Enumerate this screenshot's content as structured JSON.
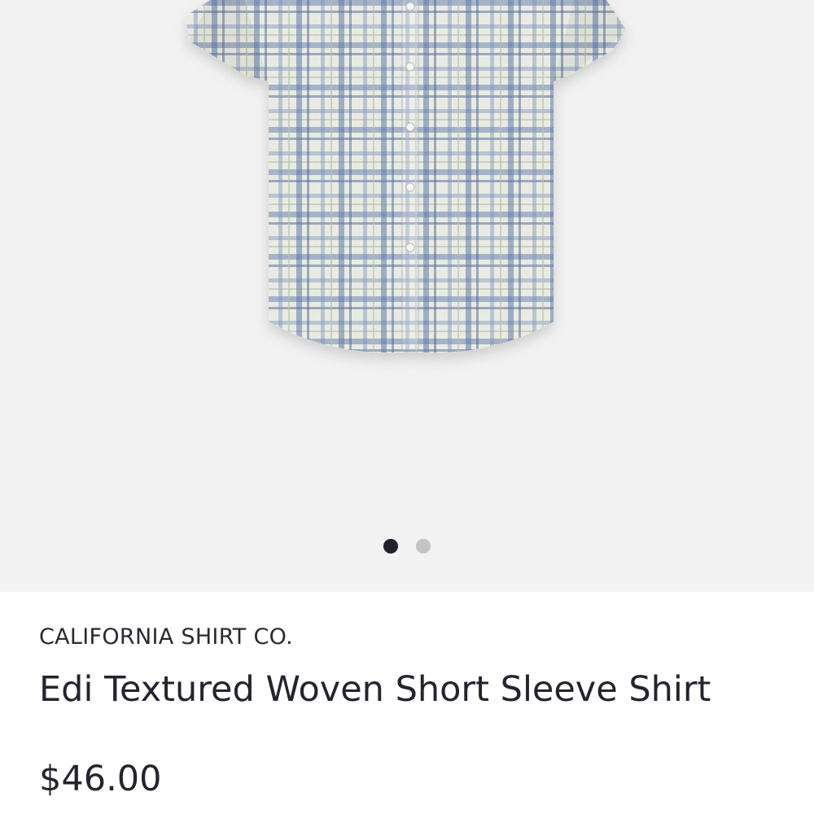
{
  "gallery": {
    "image": "plaid short sleeve shirt photo",
    "dots_total": 2,
    "active_index": 0
  },
  "product": {
    "brand": "CALIFORNIA SHIRT CO.",
    "name": "Edi Textured Woven Short Sleeve Shirt",
    "price": "$46.00"
  },
  "colors": {
    "gallery_background": "#f2f2f2",
    "shirt_base": "#e9ebe2",
    "plaid_blue": "#5f79a8",
    "text": "#24242e",
    "dot_active": "#22222e",
    "dot_inactive": "#c4c4c4"
  }
}
